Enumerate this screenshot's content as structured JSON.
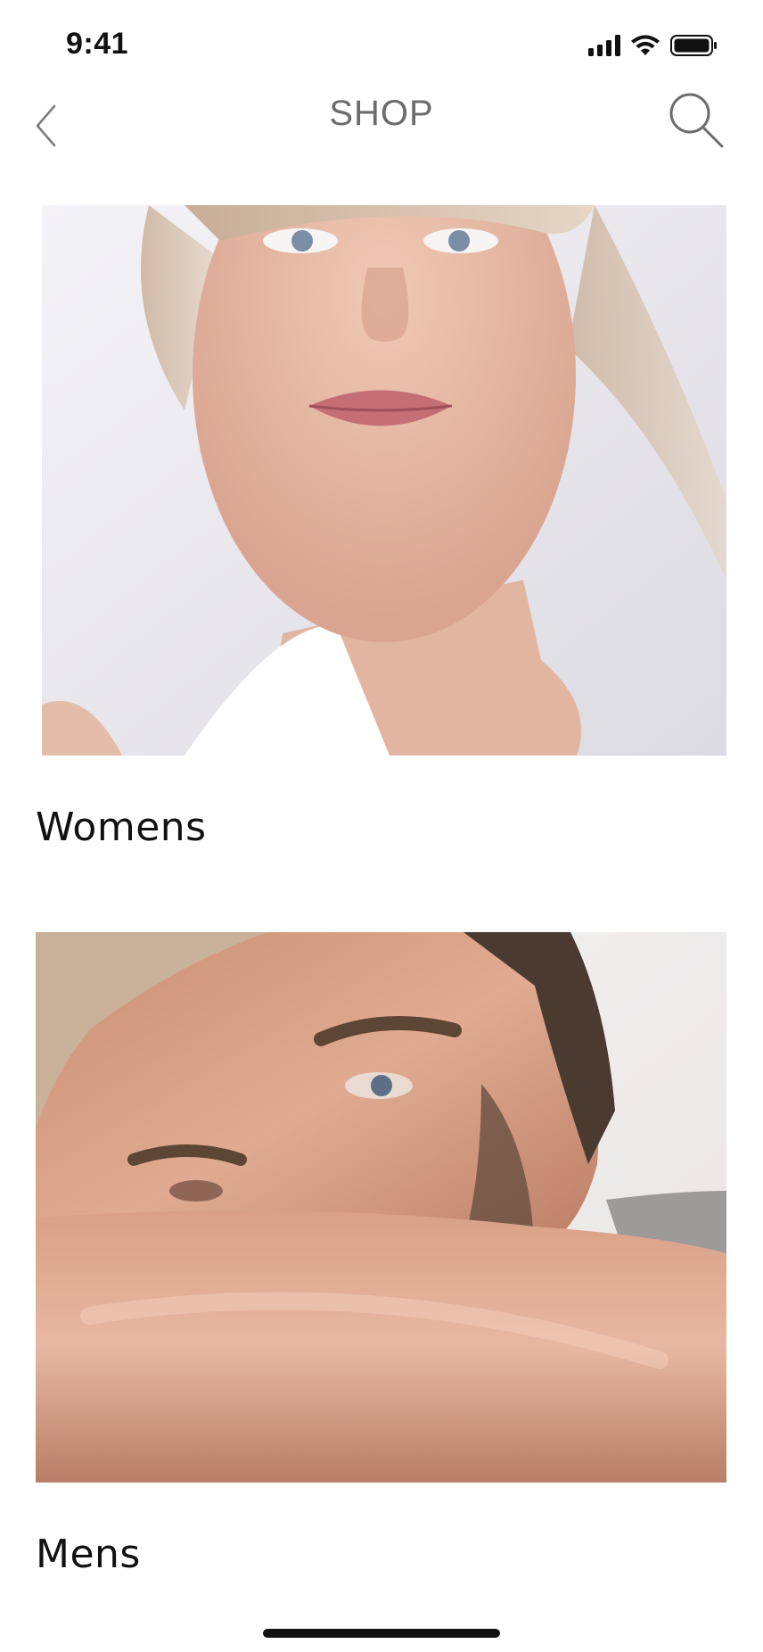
{
  "status_bar": {
    "time": "9:41"
  },
  "nav": {
    "title": "SHOP",
    "back_icon": "chevron-left-icon",
    "search_icon": "search-icon"
  },
  "categories": [
    {
      "label": "Womens",
      "image": "portrait-woman-photo"
    },
    {
      "label": "Mens",
      "image": "portrait-man-photo"
    }
  ],
  "colors": {
    "background": "#ffffff",
    "text": "#111111",
    "title": "#6c6c6c"
  }
}
